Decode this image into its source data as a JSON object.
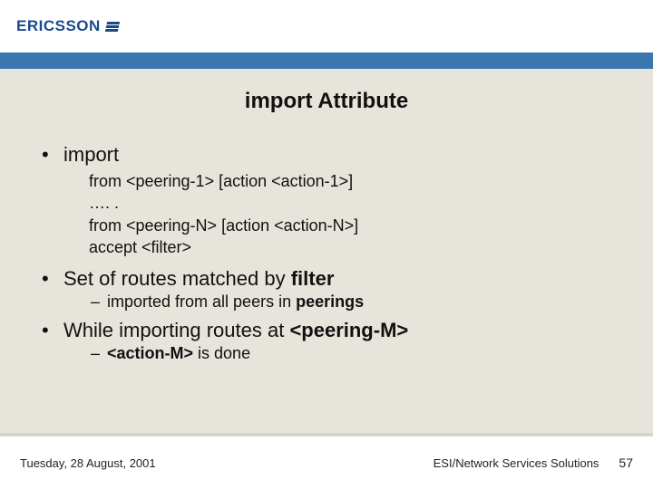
{
  "brand": {
    "name": "ERICSSON"
  },
  "slide": {
    "title": "import Attribute",
    "b1_1": "import",
    "b1_1_lines": {
      "l1": "from <peering-1> [action <action-1>]",
      "l2": "…. .",
      "l3": "from <peering-N> [action <action-N>]",
      "l4": "accept <filter>"
    },
    "b1_2_pre": "Set of routes matched by ",
    "b1_2_bold": "filter",
    "b1_2_sub_pre": "imported from all peers in ",
    "b1_2_sub_bold": "peerings",
    "b1_3_pre": "While importing routes at ",
    "b1_3_bold": "<peering-M>",
    "b1_3_sub_bold": "<action-M>",
    "b1_3_sub_post": " is done"
  },
  "footer": {
    "date": "Tuesday, 28 August, 2001",
    "org": "ESI/Network Services Solutions",
    "page": "57"
  }
}
